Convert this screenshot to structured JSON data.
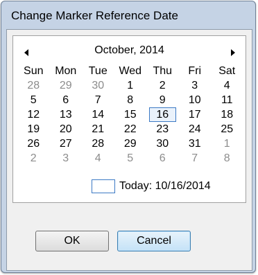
{
  "window": {
    "title": "Change Marker Reference Date"
  },
  "calendar": {
    "month_label": "October, 2014",
    "days_of_week": [
      "Sun",
      "Mon",
      "Tue",
      "Wed",
      "Thu",
      "Fri",
      "Sat"
    ],
    "weeks": [
      [
        "28",
        "29",
        "30",
        "1",
        "2",
        "3",
        "4"
      ],
      [
        "5",
        "6",
        "7",
        "8",
        "9",
        "10",
        "11"
      ],
      [
        "12",
        "13",
        "14",
        "15",
        "16",
        "17",
        "18"
      ],
      [
        "19",
        "20",
        "21",
        "22",
        "23",
        "24",
        "25"
      ],
      [
        "26",
        "27",
        "28",
        "29",
        "30",
        "31",
        "1"
      ],
      [
        "2",
        "3",
        "4",
        "5",
        "6",
        "7",
        "8"
      ]
    ],
    "today_text": "Today: 10/16/2014",
    "highlight_color": "#3b79c4"
  },
  "buttons": {
    "ok": "OK",
    "cancel": "Cancel"
  }
}
